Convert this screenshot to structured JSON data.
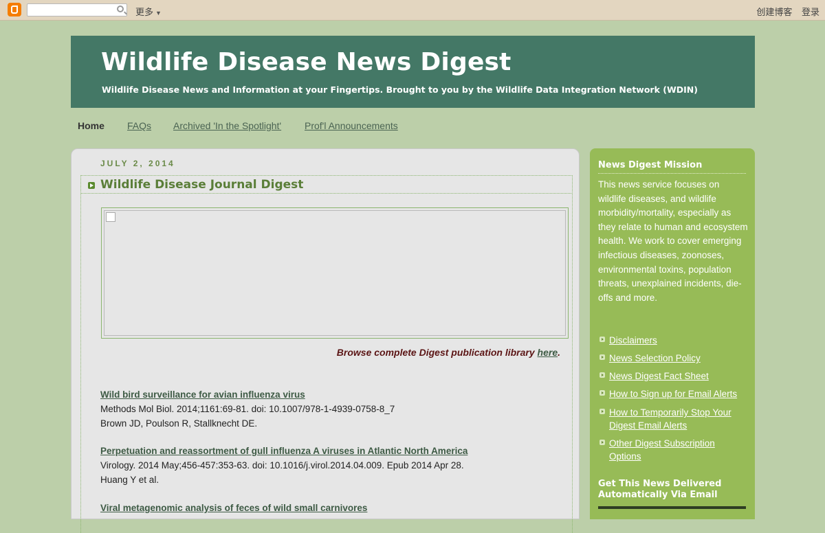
{
  "navbar": {
    "more_label": "更多",
    "create_blog": "创建博客",
    "login": "登录"
  },
  "header": {
    "title": "Wildlife Disease News Digest",
    "description": "Wildlife Disease News and Information at your Fingertips. Brought to you by the Wildlife Data Integration Network (WDIN)"
  },
  "tabs": [
    {
      "label": "Home"
    },
    {
      "label": "FAQs"
    },
    {
      "label": "Archived 'In the Spotlight'"
    },
    {
      "label": "Prof'l Announcements"
    }
  ],
  "post": {
    "date": "JULY 2, 2014",
    "title": "Wildlife Disease Journal Digest",
    "browse_text": "Browse complete Digest publication library ",
    "browse_link": "here",
    "articles": [
      {
        "title": "Wild bird surveillance for avian influenza virus",
        "citation": "Methods Mol Biol. 2014;1161:69-81. doi: 10.1007/978-1-4939-0758-8_7",
        "authors": "Brown JD, Poulson R, Stallknecht DE."
      },
      {
        "title": "Perpetuation and reassortment of gull influenza A viruses in Atlantic North America",
        "citation": "Virology. 2014 May;456-457:353-63. doi: 10.1016/j.virol.2014.04.009. Epub 2014 Apr 28.",
        "authors": "Huang Y et al."
      },
      {
        "title": "Viral metagenomic analysis of feces of wild small carnivores",
        "citation": "",
        "authors": ""
      }
    ]
  },
  "sidebar": {
    "mission_heading": "News Digest Mission",
    "mission_text": "This news service focuses on wildlife diseases, and wildlife morbidity/mortality, especially as they relate to human and ecosystem health. We work to cover emerging infectious diseases, zoonoses, environmental toxins, population threats, unexplained incidents, die-offs and more.",
    "links": [
      {
        "label": "Disclaimers"
      },
      {
        "label": "News Selection Policy"
      },
      {
        "label": "News Digest Fact Sheet"
      },
      {
        "label": "How to Sign up for Email Alerts"
      },
      {
        "label": "How to Temporarily Stop Your Digest Email Alerts"
      },
      {
        "label": "Other Digest Subscription Options"
      }
    ],
    "email_heading": "Get This News Delivered Automatically Via Email"
  }
}
